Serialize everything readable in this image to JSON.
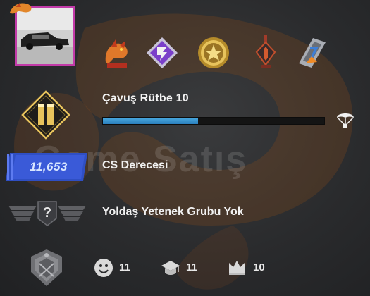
{
  "profile": {
    "rank_title": "Çavuş Rütbe 10",
    "xp_progress": 0.43,
    "cs_rating": {
      "label": "CS Derecesi",
      "value": "11,653"
    },
    "skill_group": {
      "label": "Yoldaş Yetenek Grubu Yok",
      "symbol": "?"
    }
  },
  "watermark": "Game Satış",
  "medals": [
    {
      "icon": "dragon-medal-icon"
    },
    {
      "icon": "purple-3-medal-icon"
    },
    {
      "icon": "gold-star-coin-icon"
    },
    {
      "icon": "red-sword-pin-icon"
    },
    {
      "icon": "silver-blue-7-medal-icon"
    }
  ],
  "stats": {
    "friendly": "11",
    "teacher": "11",
    "leader": "10"
  },
  "colors": {
    "avatar_border": "#c23aa8",
    "xp_fill": "#3a95d3",
    "cs_badge": "#2f4fc4",
    "rank_gold": "#e7c35c"
  }
}
